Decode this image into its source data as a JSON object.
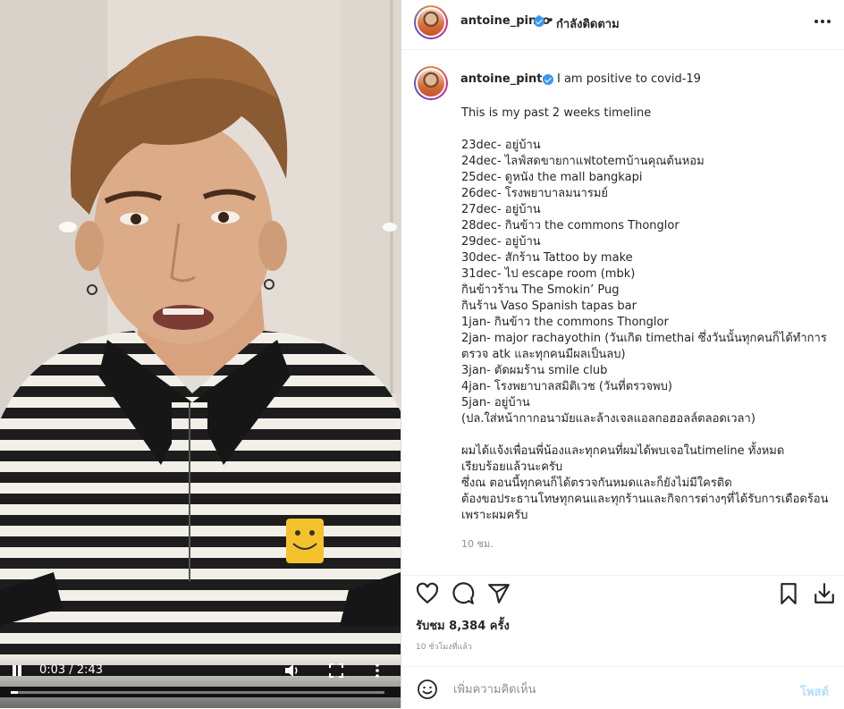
{
  "video": {
    "time": "0:03 / 2:43",
    "progress": 0.018
  },
  "header": {
    "username": "antoine_pinto",
    "dot": "•",
    "following_label": "กำลังติดตาม"
  },
  "caption": {
    "username": "antoine_pinto",
    "first_line": "I am positive to covid-19",
    "body": "This is my past 2 weeks timeline\n\n23dec- อยู่บ้าน\n24dec- ไลฟ์สดขายกาแฟtotemบ้านคุณต้นหอม\n25dec- ดูหนัง the mall bangkapi\n26dec- โรงพยาบาลมนารมย์\n27dec- อยู่บ้าน\n28dec- กินข้าว the commons Thonglor\n29dec- อยู่บ้าน\n30dec- สักร้าน Tattoo by make\n31dec- ไป escape room (mbk)\nกินข้าวร้าน The Smokin’ Pug\nกินร้าน Vaso Spanish tapas bar\n1jan- กินข้าว the commons Thonglor\n2jan- major rachayothin (วันเกิด timethai ซึ่งวันนั้นทุกคนก็ได้ทำการ\nตรวจ atk และทุกคนมีผลเป็นลบ)\n3jan- ตัดผมร้าน smile club\n4jan- โรงพยาบาลสมิติเวช (วันที่ตรวจพบ)\n5jan- อยู่บ้าน\n(ปล.ใส่หน้ากากอนามัยและล้างเจลแอลกอฮอลล์ตลอดเวลา)\n\nผมได้แจ้งเพื่อนพี่น้องและทุกคนที่ผมได้พบเจอในtimeline ทั้งหมด\nเรียบร้อยแล้วนะครับ\nซึ่งณ ตอนนี้ทุกคนก็ได้ตรวจกันหมดและก็ยังไม่มีใครติด\nต้องขอประธานโทษทุกคนและทุกร้านและกิจการต่างๆที่ได้รับการเดือดร้อน\nเพราะผมครับ",
    "time": "10 ชม."
  },
  "stats": {
    "views": "รับชม 8,384 ครั้ง",
    "posted": "10 ชั่วโมงที่แล้ว"
  },
  "comment": {
    "placeholder": "เพิ่มความคิดเห็น",
    "post_label": "โพสต์"
  },
  "icons": {
    "like": "heart-icon",
    "comment": "comment-icon",
    "share": "paper-plane-icon",
    "save": "bookmark-icon",
    "download": "download-icon",
    "emoji": "emoji-icon"
  },
  "colors": {
    "verified": "#3897f0",
    "post_button": "#b2dffc",
    "muted_text": "#8e8e8e"
  }
}
